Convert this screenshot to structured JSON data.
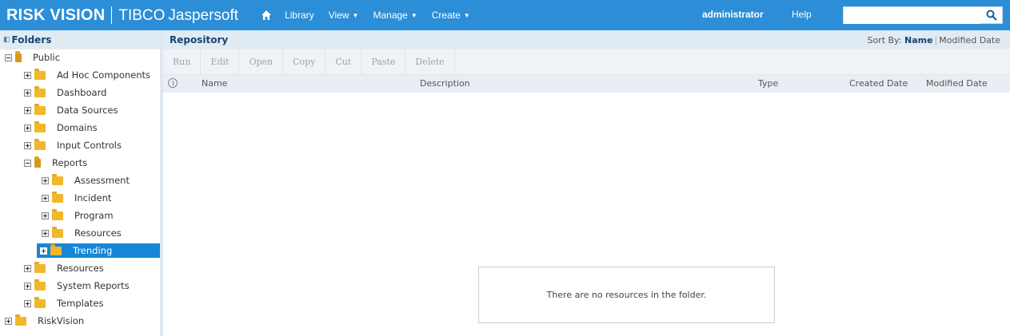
{
  "brand": {
    "riskvision": "RISK VISION",
    "tibco": "TIBCO",
    "jaspersoft": "Jaspersoft"
  },
  "nav": {
    "home_icon": "home-icon",
    "library": "Library",
    "view": "View",
    "manage": "Manage",
    "create": "Create"
  },
  "header_right": {
    "user": "administrator",
    "help": "Help",
    "search_placeholder": "",
    "search_icon": "search-icon"
  },
  "sidebar": {
    "title": "Folders",
    "tree": [
      {
        "label": "Public",
        "expanded": true
      },
      {
        "label": "Ad Hoc Components"
      },
      {
        "label": "Dashboard"
      },
      {
        "label": "Data Sources"
      },
      {
        "label": "Domains"
      },
      {
        "label": "Input Controls"
      },
      {
        "label": "Reports",
        "expanded": true
      },
      {
        "label": "Assessment"
      },
      {
        "label": "Incident"
      },
      {
        "label": "Program"
      },
      {
        "label": "Resources"
      },
      {
        "label": "Trending",
        "selected": true
      },
      {
        "label": "Resources"
      },
      {
        "label": "System Reports"
      },
      {
        "label": "Templates"
      },
      {
        "label": "RiskVision"
      }
    ]
  },
  "main": {
    "title": "Repository",
    "sort": {
      "label": "Sort By:",
      "name": "Name",
      "modified": "Modified Date"
    },
    "toolbar": [
      "Run",
      "Edit",
      "Open",
      "Copy",
      "Cut",
      "Paste",
      "Delete"
    ],
    "columns": {
      "name": "Name",
      "description": "Description",
      "type": "Type",
      "created": "Created Date",
      "modified": "Modified Date"
    },
    "empty_message": "There are no resources in the folder."
  },
  "colors": {
    "topbar": "#2c8ed6",
    "selected": "#1786d7",
    "header_bg": "#e1ebf4"
  }
}
